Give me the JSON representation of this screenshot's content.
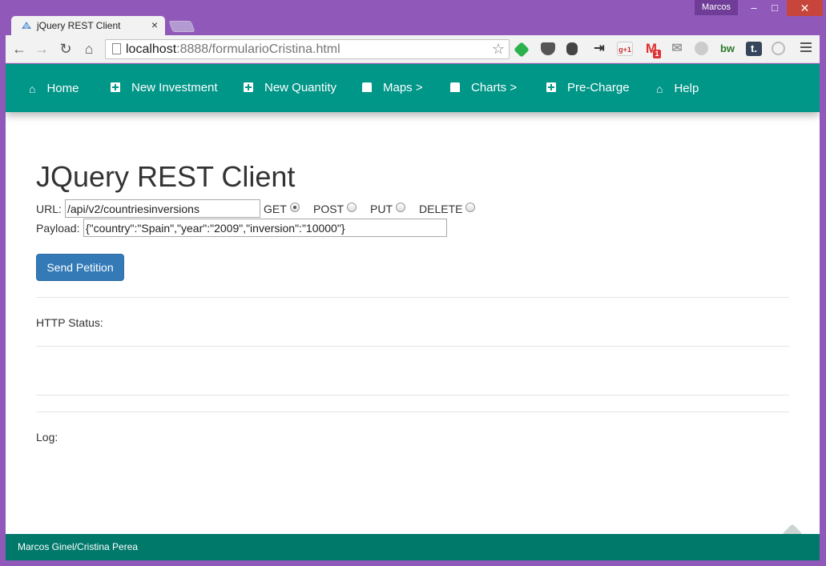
{
  "window": {
    "user": "Marcos",
    "minimize": "–",
    "maximize": "□",
    "close": "✕"
  },
  "tab": {
    "title": "jQuery REST Client",
    "close": "×"
  },
  "toolbar": {
    "url_host": "localhost",
    "url_rest": ":8888/formularioCristina.html",
    "extensions": [
      "feedly-icon",
      "pocket-icon",
      "evernote-icon",
      "pushbullet-icon",
      "google-plus-icon",
      "gmail-icon",
      "mail-icon",
      "wikipedia-icon",
      "bw-icon",
      "tumblr-icon",
      "steering-icon"
    ],
    "gplus_label": "g+1",
    "gmail_label": "M",
    "gmail_count": "1",
    "bw_label": "bw",
    "tumblr_label": "t."
  },
  "navbar": {
    "items": [
      {
        "label": "Home",
        "icon": "home-icon"
      },
      {
        "label": "New Investment",
        "icon": "plus-icon"
      },
      {
        "label": "New Quantity",
        "icon": "plus-icon"
      },
      {
        "label": "Maps >",
        "icon": "chart-bar-icon"
      },
      {
        "label": "Charts >",
        "icon": "chart-bar-icon"
      },
      {
        "label": "Pre-Charge",
        "icon": "plus-icon"
      },
      {
        "label": "Help",
        "icon": "home-icon"
      }
    ]
  },
  "main": {
    "title": "JQuery REST Client",
    "url_label": "URL:",
    "url_value": "/api/v2/countriesinversions",
    "methods": [
      {
        "label": "GET",
        "checked": true
      },
      {
        "label": "POST",
        "checked": false
      },
      {
        "label": "PUT",
        "checked": false
      },
      {
        "label": "DELETE",
        "checked": false
      }
    ],
    "payload_label": "Payload:",
    "payload_value": "{\"country\":\"Spain\",\"year\":\"2009\",\"inversion\":\"10000\"}",
    "send_button": "Send Petition",
    "http_status_label": "HTTP Status:",
    "log_label": "Log:"
  },
  "footer": {
    "text": "Marcos Ginel/Cristina Perea"
  },
  "colors": {
    "navbar": "#009688",
    "footer": "#00796b",
    "button": "#337ab7",
    "window": "#9059b9"
  }
}
